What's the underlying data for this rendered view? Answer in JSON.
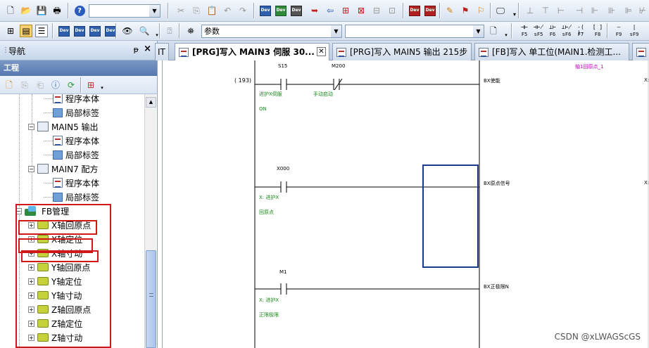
{
  "toolbar": {
    "search_label": "参数"
  },
  "function_keys": [
    "F5",
    "sF5",
    "F6",
    "sF6",
    "F7",
    "F8",
    "F9",
    "sF9"
  ],
  "nav": {
    "title": "导航",
    "pin": "ᵽ",
    "close": "×",
    "section": "工程",
    "tree": [
      {
        "label": "程序本体",
        "icon": "program-body-icon"
      },
      {
        "label": "局部标签",
        "icon": "local-label-icon"
      },
      {
        "label": "MAIN5 输出",
        "icon": "program-icon",
        "expander": "⊟"
      },
      {
        "label": "程序本体",
        "icon": "program-body-icon"
      },
      {
        "label": "局部标签",
        "icon": "local-label-icon"
      },
      {
        "label": "MAIN7 配方",
        "icon": "program-icon",
        "expander": "⊟"
      },
      {
        "label": "程序本体",
        "icon": "program-body-icon"
      },
      {
        "label": "局部标签",
        "icon": "local-label-icon"
      },
      {
        "label": "FB管理",
        "icon": "fb-manager-icon",
        "expander": "⊟"
      },
      {
        "label": "X轴回原点",
        "icon": "fb-folder-icon",
        "expander": "+"
      },
      {
        "label": "X轴定位",
        "icon": "fb-folder-icon",
        "expander": "+"
      },
      {
        "label": "X轴寸动",
        "icon": "fb-folder-icon",
        "expander": "+"
      },
      {
        "label": "Y轴回原点",
        "icon": "fb-folder-icon",
        "expander": "+"
      },
      {
        "label": "Y轴定位",
        "icon": "fb-folder-icon",
        "expander": "+"
      },
      {
        "label": "Y轴寸动",
        "icon": "fb-folder-icon",
        "expander": "+"
      },
      {
        "label": "Z轴回原点",
        "icon": "fb-folder-icon",
        "expander": "+"
      },
      {
        "label": "Z轴定位",
        "icon": "fb-folder-icon",
        "expander": "+"
      },
      {
        "label": "Z轴寸动",
        "icon": "fb-folder-icon",
        "expander": "+"
      }
    ]
  },
  "tabs": [
    {
      "label": "IT",
      "active": false
    },
    {
      "label": "[PRG]写入 MAIN3 伺服 30...",
      "active": true
    },
    {
      "label": "[PRG]写入 MAIN5 输出 215步",
      "active": false
    },
    {
      "label": "[FB]写入 单工位(MAIN1.检测工...",
      "active": false
    }
  ],
  "ladder": {
    "step": "( 193)",
    "rung1": {
      "contact1": "S15",
      "contact2": "M200",
      "c1_comment": "进护X伺服",
      "c1_state": "ON",
      "c2_comment": "手动启动",
      "output": "BX使能",
      "fb_instance": "轴1回原点_1",
      "right_label": "X:"
    },
    "rung2": {
      "contact": "X000",
      "comment1": "X: 进护X",
      "comment2": "回原点",
      "output": "BX原点信号",
      "right_label": "X:"
    },
    "rung3": {
      "contact": "M1",
      "comment1": "X: 进护X",
      "comment2": "正限极限",
      "output": "BX正极限N"
    }
  },
  "watermark": "CSDN @xLWAGScGS"
}
